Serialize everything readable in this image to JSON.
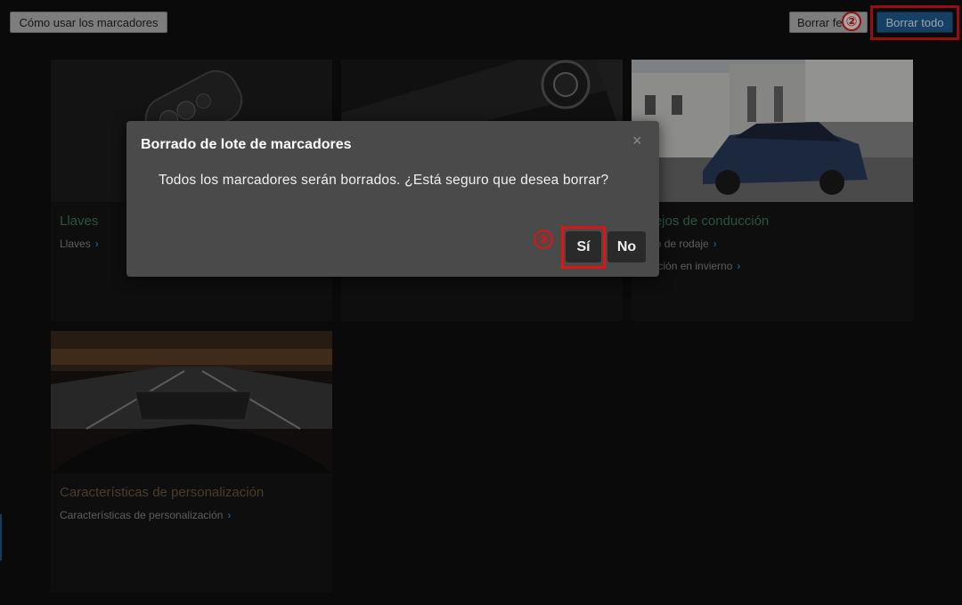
{
  "toolbar": {
    "howto_label": "Cómo usar los marcadores",
    "delete_selected_label": "Borrar fe",
    "delete_all_label": "Borrar todo",
    "accent": "#1f5f93"
  },
  "callouts": {
    "two": "②",
    "three": "③",
    "color": "#e11414"
  },
  "cards": [
    {
      "title": "Llaves",
      "links": [
        "Llaves"
      ]
    },
    {
      "title": "",
      "links": []
    },
    {
      "title": "nsejos de conducción",
      "links": [
        "íodo de rodaje",
        "ducción en invierno"
      ]
    },
    {
      "title": "Características de personalización",
      "links": [
        "Características de personalización"
      ]
    }
  ],
  "dialog": {
    "title": "Borrado de lote de marcadores",
    "close_icon": "×",
    "message": "Todos los marcadores serán borrados. ¿Está seguro que desea borrar?",
    "yes_label": "Sí",
    "no_label": "No"
  }
}
